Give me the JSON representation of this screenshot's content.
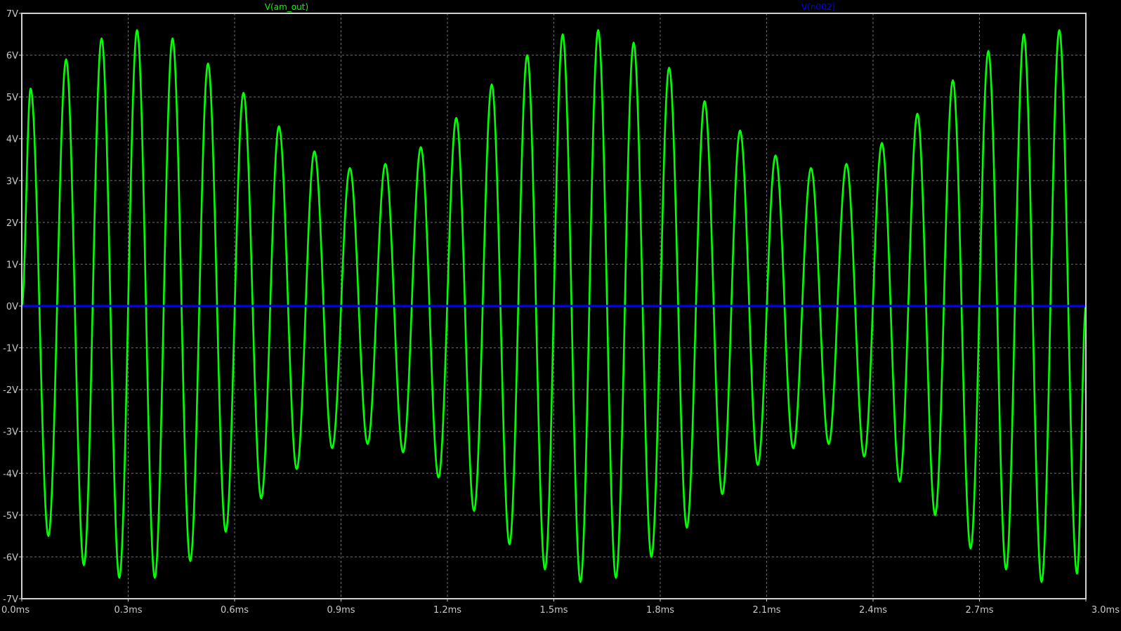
{
  "chart_data": {
    "type": "line",
    "background": "#000000",
    "grid": true,
    "grid_color": "#6e6e6e",
    "frame_color": "#d0d0d0",
    "xlim": [
      0,
      3.0
    ],
    "ylim": [
      -7,
      7
    ],
    "x_ticks": [
      0,
      0.3,
      0.6,
      0.9,
      1.2,
      1.5,
      1.8,
      2.1,
      2.4,
      2.7,
      3.0
    ],
    "x_tick_labels": [
      "0.0ms",
      "0.3ms",
      "0.6ms",
      "0.9ms",
      "1.2ms",
      "1.5ms",
      "1.8ms",
      "2.1ms",
      "2.4ms",
      "2.7ms",
      "3.0ms"
    ],
    "y_ticks": [
      7,
      6,
      5,
      4,
      3,
      2,
      1,
      0,
      -1,
      -2,
      -3,
      -4,
      -5,
      -6,
      -7
    ],
    "y_tick_labels": [
      "7V",
      "6V",
      "5V",
      "4V",
      "3V",
      "2V",
      "1V",
      "0V",
      "-1V",
      "-2V",
      "-3V",
      "-4V",
      "-5V",
      "-6V",
      "-7V"
    ],
    "series": [
      {
        "name": "V(am_out)",
        "color": "#00ff00",
        "x_unit": "ms",
        "y_unit": "V",
        "points": [
          [
            0.0,
            0.0
          ],
          [
            0.025,
            5.2
          ],
          [
            0.075,
            -5.5
          ],
          [
            0.125,
            5.9
          ],
          [
            0.175,
            -6.2
          ],
          [
            0.225,
            6.4
          ],
          [
            0.275,
            -6.5
          ],
          [
            0.325,
            6.6
          ],
          [
            0.375,
            -6.5
          ],
          [
            0.425,
            6.4
          ],
          [
            0.475,
            -6.1
          ],
          [
            0.525,
            5.8
          ],
          [
            0.575,
            -5.4
          ],
          [
            0.625,
            5.1
          ],
          [
            0.675,
            -4.6
          ],
          [
            0.725,
            4.3
          ],
          [
            0.775,
            -3.9
          ],
          [
            0.825,
            3.7
          ],
          [
            0.875,
            -3.4
          ],
          [
            0.925,
            3.3
          ],
          [
            0.975,
            -3.3
          ],
          [
            1.025,
            3.4
          ],
          [
            1.075,
            -3.5
          ],
          [
            1.125,
            3.8
          ],
          [
            1.175,
            -4.1
          ],
          [
            1.225,
            4.5
          ],
          [
            1.275,
            -4.9
          ],
          [
            1.325,
            5.3
          ],
          [
            1.375,
            -5.7
          ],
          [
            1.425,
            6.0
          ],
          [
            1.475,
            -6.3
          ],
          [
            1.525,
            6.5
          ],
          [
            1.575,
            -6.6
          ],
          [
            1.625,
            6.6
          ],
          [
            1.675,
            -6.5
          ],
          [
            1.725,
            6.3
          ],
          [
            1.775,
            -6.0
          ],
          [
            1.825,
            5.7
          ],
          [
            1.875,
            -5.3
          ],
          [
            1.925,
            4.9
          ],
          [
            1.975,
            -4.5
          ],
          [
            2.025,
            4.2
          ],
          [
            2.075,
            -3.8
          ],
          [
            2.125,
            3.6
          ],
          [
            2.175,
            -3.4
          ],
          [
            2.225,
            3.3
          ],
          [
            2.275,
            -3.3
          ],
          [
            2.325,
            3.4
          ],
          [
            2.375,
            -3.6
          ],
          [
            2.425,
            3.9
          ],
          [
            2.475,
            -4.2
          ],
          [
            2.525,
            4.6
          ],
          [
            2.575,
            -5.0
          ],
          [
            2.625,
            5.4
          ],
          [
            2.675,
            -5.8
          ],
          [
            2.725,
            6.1
          ],
          [
            2.775,
            -6.3
          ],
          [
            2.825,
            6.5
          ],
          [
            2.875,
            -6.6
          ],
          [
            2.925,
            6.6
          ],
          [
            2.975,
            -6.4
          ],
          [
            3.0,
            0.0
          ]
        ]
      },
      {
        "name": "V(n002)",
        "color": "#0000ff",
        "x_unit": "ms",
        "y_unit": "V",
        "points": [
          [
            0.0,
            0.0
          ],
          [
            3.0,
            0.0
          ]
        ]
      }
    ]
  }
}
